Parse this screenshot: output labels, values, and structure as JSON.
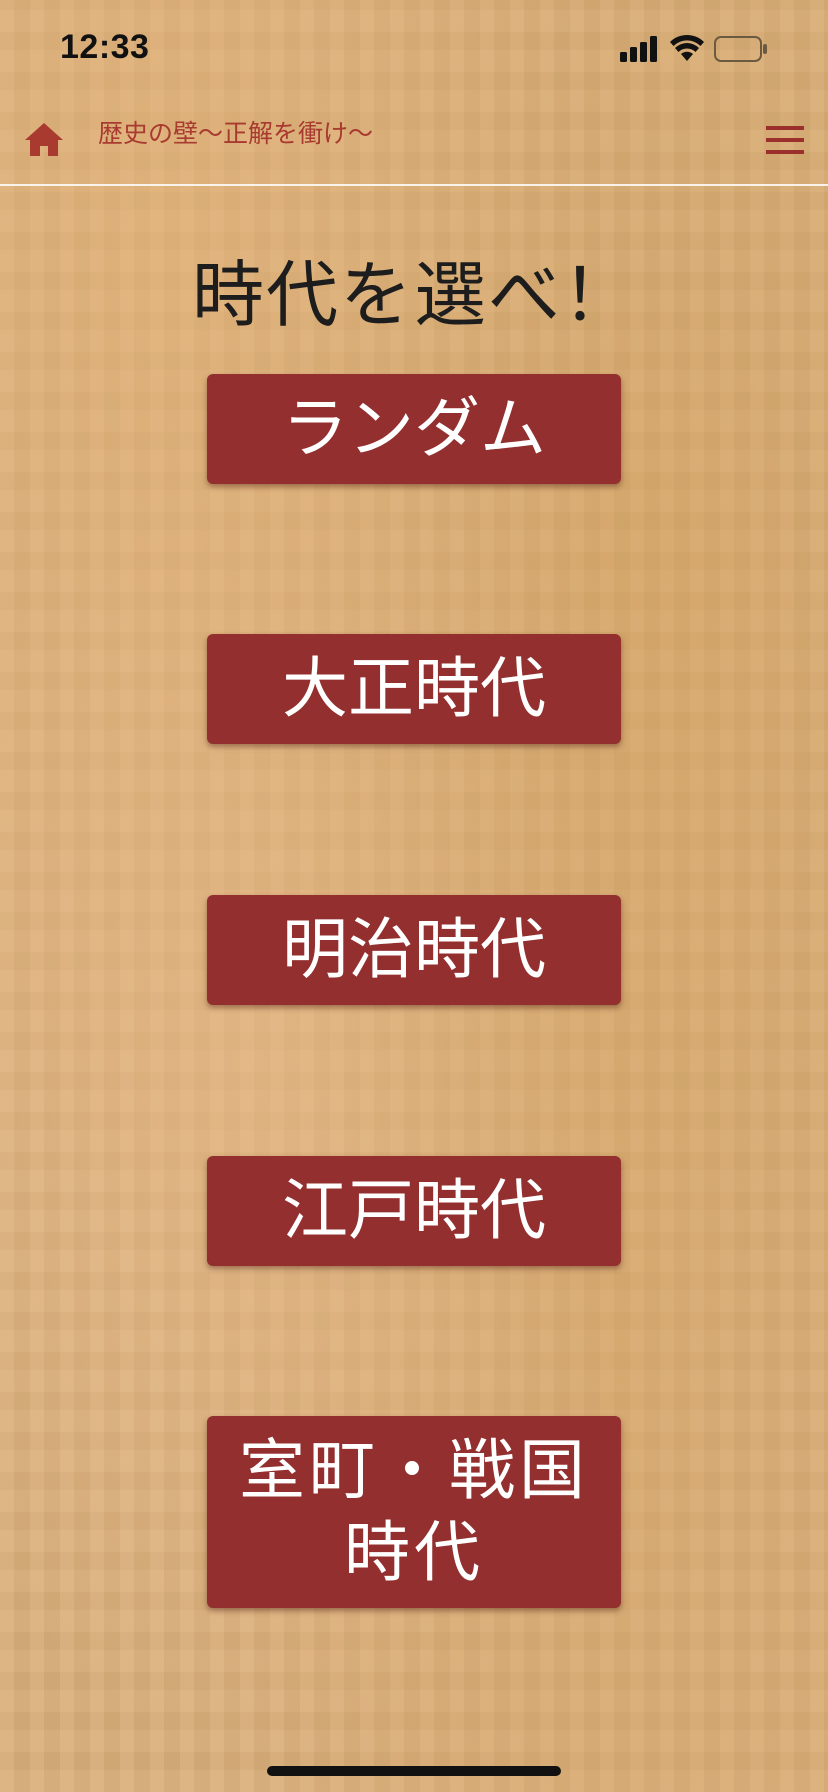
{
  "status_bar": {
    "time": "12:33",
    "icons": [
      "signal-icon",
      "wifi-icon",
      "battery-icon"
    ]
  },
  "header": {
    "title": "歴史の壁〜正解を衝け〜",
    "home_icon": "home-icon",
    "menu_icon": "hamburger-menu-icon"
  },
  "main": {
    "heading": "時代を選べ！",
    "era_buttons": [
      {
        "label": "ランダム"
      },
      {
        "label": "大正時代"
      },
      {
        "label": "明治時代"
      },
      {
        "label": "江戸時代"
      },
      {
        "label": "室町・戦国時代"
      }
    ]
  },
  "colors": {
    "accent": "#93302f",
    "header_title": "#a83a30",
    "background": "#dbb07c"
  }
}
